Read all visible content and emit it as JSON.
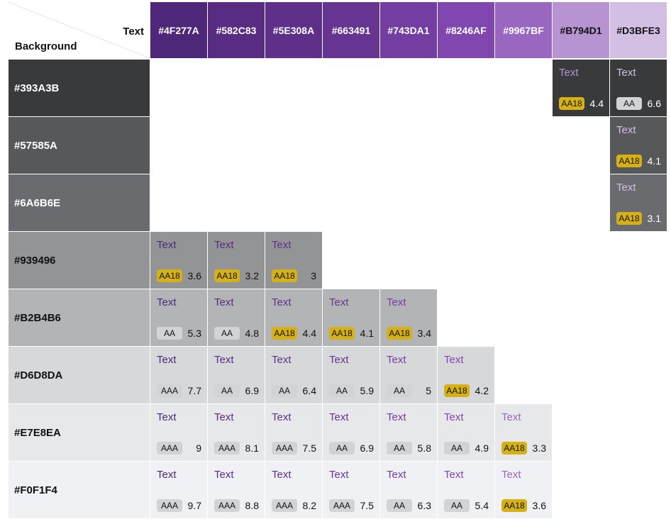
{
  "corner": {
    "text_label": "Text",
    "background_label": "Background"
  },
  "columns": [
    {
      "hex": "#4F277A",
      "bg": "#4F277A",
      "fg": "#ffffff"
    },
    {
      "hex": "#582C83",
      "bg": "#582C83",
      "fg": "#ffffff"
    },
    {
      "hex": "#5E308A",
      "bg": "#5E308A",
      "fg": "#ffffff"
    },
    {
      "hex": "#663491",
      "bg": "#663491",
      "fg": "#ffffff"
    },
    {
      "hex": "#743DA1",
      "bg": "#743DA1",
      "fg": "#ffffff"
    },
    {
      "hex": "#8246AF",
      "bg": "#8246AF",
      "fg": "#ffffff"
    },
    {
      "hex": "#9967BF",
      "bg": "#9967BF",
      "fg": "#ffffff"
    },
    {
      "hex": "#B794D1",
      "bg": "#B794D1",
      "fg": "#111111"
    },
    {
      "hex": "#D3BFE3",
      "bg": "#D3BFE3",
      "fg": "#111111"
    }
  ],
  "rows": [
    {
      "hex": "#393A3B",
      "bg": "#393A3B",
      "fg": "#ffffff",
      "ratio_color": "#ffffff"
    },
    {
      "hex": "#57585A",
      "bg": "#57585A",
      "fg": "#ffffff",
      "ratio_color": "#ffffff"
    },
    {
      "hex": "#6A6B6E",
      "bg": "#6A6B6E",
      "fg": "#ffffff",
      "ratio_color": "#ffffff"
    },
    {
      "hex": "#939496",
      "bg": "#939496",
      "fg": "#111111",
      "ratio_color": "#111111"
    },
    {
      "hex": "#B2B4B6",
      "bg": "#B2B4B6",
      "fg": "#111111",
      "ratio_color": "#111111"
    },
    {
      "hex": "#D6D8DA",
      "bg": "#D6D8DA",
      "fg": "#111111",
      "ratio_color": "#111111"
    },
    {
      "hex": "#E7E8EA",
      "bg": "#E7E8EA",
      "fg": "#111111",
      "ratio_color": "#111111"
    },
    {
      "hex": "#F0F1F4",
      "bg": "#F0F1F4",
      "fg": "#111111",
      "ratio_color": "#111111"
    }
  ],
  "sample_text": "Text",
  "cells": [
    {
      "row": 0,
      "col": 7,
      "badge": "AA18",
      "ratio": "4.4"
    },
    {
      "row": 0,
      "col": 8,
      "badge": "AA",
      "ratio": "6.6"
    },
    {
      "row": 1,
      "col": 8,
      "badge": "AA18",
      "ratio": "4.1"
    },
    {
      "row": 2,
      "col": 8,
      "badge": "AA18",
      "ratio": "3.1"
    },
    {
      "row": 3,
      "col": 0,
      "badge": "AA18",
      "ratio": "3.6"
    },
    {
      "row": 3,
      "col": 1,
      "badge": "AA18",
      "ratio": "3.2"
    },
    {
      "row": 3,
      "col": 2,
      "badge": "AA18",
      "ratio": "3"
    },
    {
      "row": 4,
      "col": 0,
      "badge": "AA",
      "ratio": "5.3"
    },
    {
      "row": 4,
      "col": 1,
      "badge": "AA",
      "ratio": "4.8"
    },
    {
      "row": 4,
      "col": 2,
      "badge": "AA18",
      "ratio": "4.4"
    },
    {
      "row": 4,
      "col": 3,
      "badge": "AA18",
      "ratio": "4.1"
    },
    {
      "row": 4,
      "col": 4,
      "badge": "AA18",
      "ratio": "3.4"
    },
    {
      "row": 5,
      "col": 0,
      "badge": "AAA",
      "ratio": "7.7"
    },
    {
      "row": 5,
      "col": 1,
      "badge": "AA",
      "ratio": "6.9"
    },
    {
      "row": 5,
      "col": 2,
      "badge": "AA",
      "ratio": "6.4"
    },
    {
      "row": 5,
      "col": 3,
      "badge": "AA",
      "ratio": "5.9"
    },
    {
      "row": 5,
      "col": 4,
      "badge": "AA",
      "ratio": "5"
    },
    {
      "row": 5,
      "col": 5,
      "badge": "AA18",
      "ratio": "4.2"
    },
    {
      "row": 6,
      "col": 0,
      "badge": "AAA",
      "ratio": "9"
    },
    {
      "row": 6,
      "col": 1,
      "badge": "AAA",
      "ratio": "8.1"
    },
    {
      "row": 6,
      "col": 2,
      "badge": "AAA",
      "ratio": "7.5"
    },
    {
      "row": 6,
      "col": 3,
      "badge": "AA",
      "ratio": "6.9"
    },
    {
      "row": 6,
      "col": 4,
      "badge": "AA",
      "ratio": "5.8"
    },
    {
      "row": 6,
      "col": 5,
      "badge": "AA",
      "ratio": "4.9"
    },
    {
      "row": 6,
      "col": 6,
      "badge": "AA18",
      "ratio": "3.3"
    },
    {
      "row": 7,
      "col": 0,
      "badge": "AAA",
      "ratio": "9.7"
    },
    {
      "row": 7,
      "col": 1,
      "badge": "AAA",
      "ratio": "8.8"
    },
    {
      "row": 7,
      "col": 2,
      "badge": "AAA",
      "ratio": "8.2"
    },
    {
      "row": 7,
      "col": 3,
      "badge": "AAA",
      "ratio": "7.5"
    },
    {
      "row": 7,
      "col": 4,
      "badge": "AA",
      "ratio": "6.3"
    },
    {
      "row": 7,
      "col": 5,
      "badge": "AA",
      "ratio": "5.4"
    },
    {
      "row": 7,
      "col": 6,
      "badge": "AA18",
      "ratio": "3.6"
    }
  ]
}
